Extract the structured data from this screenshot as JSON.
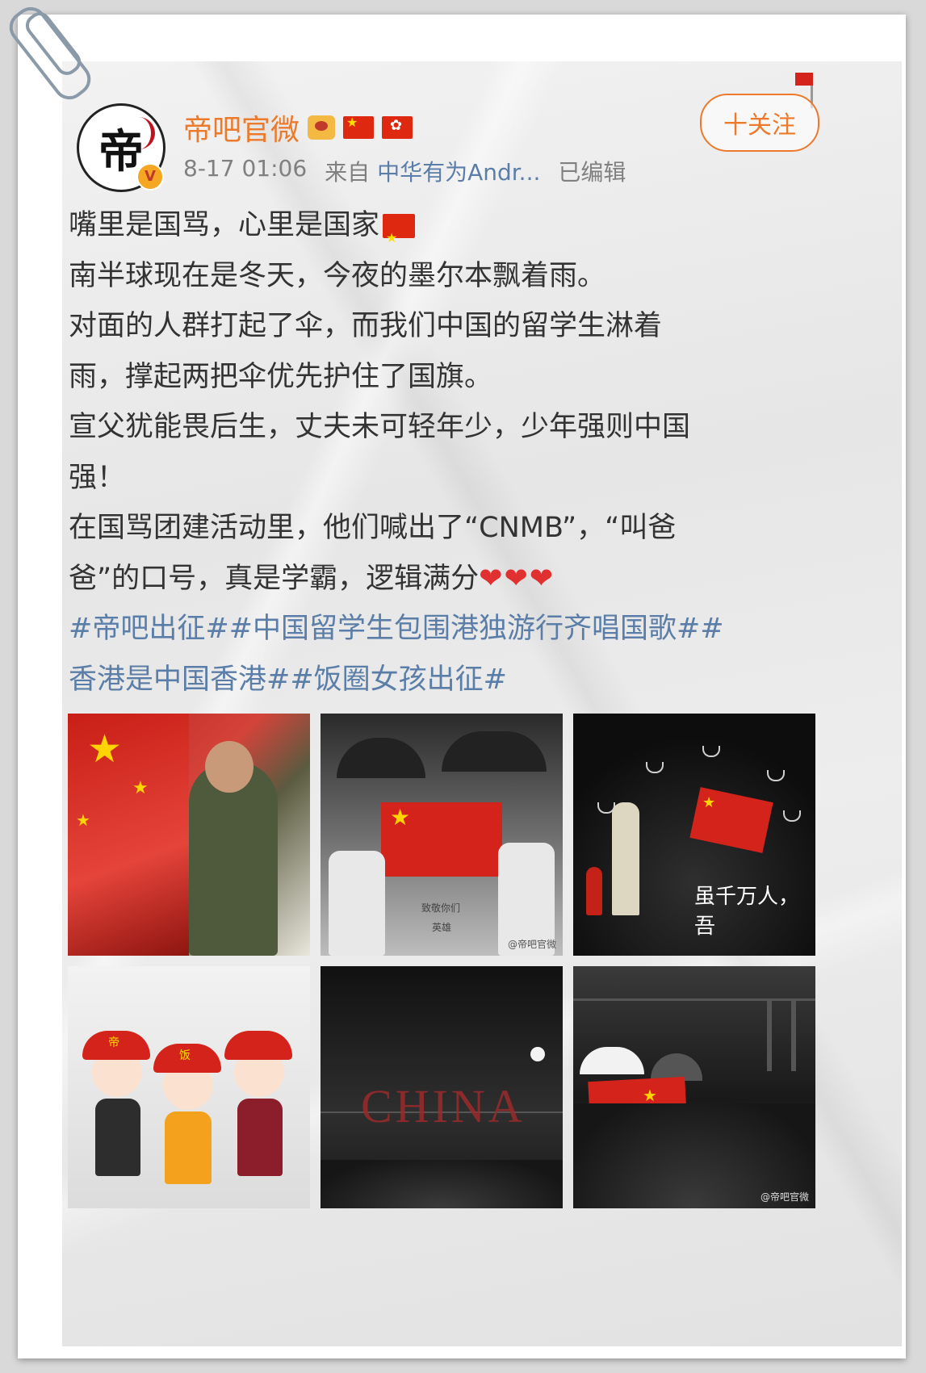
{
  "post": {
    "username": "帝吧官微",
    "avatar_text": "帝",
    "verified_mark": "V",
    "follow_label": "十关注",
    "timestamp": "8-17 01:06",
    "source_prefix": "来自",
    "source_app": "中华有为Andr...",
    "edited_label": "已编辑",
    "lines": [
      "嘴里是国骂，心里是国家",
      "南半球现在是冬天，今夜的墨尔本飘着雨。",
      "对面的人群打起了伞，而我们中国的留学生淋着",
      "雨，撑起两把伞优先护住了国旗。",
      "宣父犹能畏后生，丈夫未可轻年少，少年强则中国",
      "强！",
      "在国骂团建活动里，他们喊出了“CNMB”，“叫爸",
      "爸”的口号，真是学霸，逻辑满分"
    ],
    "hearts": "❤❤❤",
    "hashtags": [
      "#帝吧出征##中国留学生包围港独游行齐唱国歌##",
      "香港是中国香港##饭圈女孩出征#"
    ]
  },
  "images": {
    "tile2_caption_1": "致敬你们",
    "tile2_caption_2": "英雄",
    "tile2_watermark": "@帝吧官微",
    "tile3_text": "虽千万人，吾",
    "tile4_cap_1": "帝",
    "tile4_cap_2": "饭",
    "tile5_text": "CHINA",
    "tile6_watermark": "@帝吧官微"
  },
  "colors": {
    "username": "#ec7a2c",
    "link": "#5b7ea8",
    "flag_red": "#de2910",
    "heart": "#e0302f"
  },
  "icons": [
    "crown-icon",
    "china-flag-icon",
    "hong-kong-flag-icon",
    "verified-icon",
    "paperclip-icon"
  ]
}
